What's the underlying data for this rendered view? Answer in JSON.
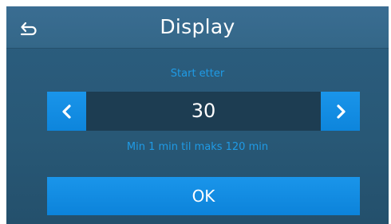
{
  "header": {
    "title": "Display",
    "back_icon": "back-arrow-icon"
  },
  "timer": {
    "label": "Start etter",
    "value": "30",
    "hint": "Min 1 min til maks 120 min",
    "decrement_icon": "chevron-left-icon",
    "increment_icon": "chevron-right-icon"
  },
  "actions": {
    "ok_label": "OK"
  },
  "colors": {
    "accent": "#1a95ea",
    "label_text": "#1f9be6",
    "background": "#2c5e80",
    "header": "#3a6d92",
    "value_field": "#1d3d52"
  }
}
